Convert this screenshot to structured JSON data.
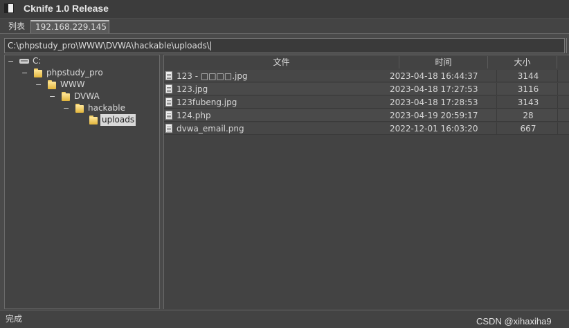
{
  "window": {
    "title": "Cknife 1.0 Release"
  },
  "tabs": [
    {
      "label": "列表"
    },
    {
      "label": "192.168.229.145"
    }
  ],
  "path": {
    "value": "C:\\phpstudy_pro\\WWW\\DVWA\\hackable\\uploads\\"
  },
  "tree": {
    "items": [
      {
        "label": "C:",
        "toggle": "−"
      },
      {
        "label": "phpstudy_pro",
        "toggle": "−"
      },
      {
        "label": "WWW",
        "toggle": "−"
      },
      {
        "label": "DVWA",
        "toggle": "−"
      },
      {
        "label": "hackable",
        "toggle": "−"
      },
      {
        "label": "uploads",
        "toggle": ""
      }
    ]
  },
  "file_list": {
    "headers": {
      "name": "文件",
      "time": "时间",
      "size": "大小"
    },
    "rows": [
      {
        "name": "123 - □□□□.jpg",
        "time": "2023-04-18 16:44:37",
        "size": "3144"
      },
      {
        "name": "123.jpg",
        "time": "2023-04-18 17:27:53",
        "size": "3116"
      },
      {
        "name": "123fubeng.jpg",
        "time": "2023-04-18 17:28:53",
        "size": "3143"
      },
      {
        "name": "124.php",
        "time": "2023-04-19 20:59:17",
        "size": "28"
      },
      {
        "name": "dvwa_email.png",
        "time": "2022-12-01 16:03:20",
        "size": "667"
      }
    ]
  },
  "status": {
    "text": "完成"
  },
  "watermark": {
    "text": "CSDN @xihaxiha9"
  }
}
